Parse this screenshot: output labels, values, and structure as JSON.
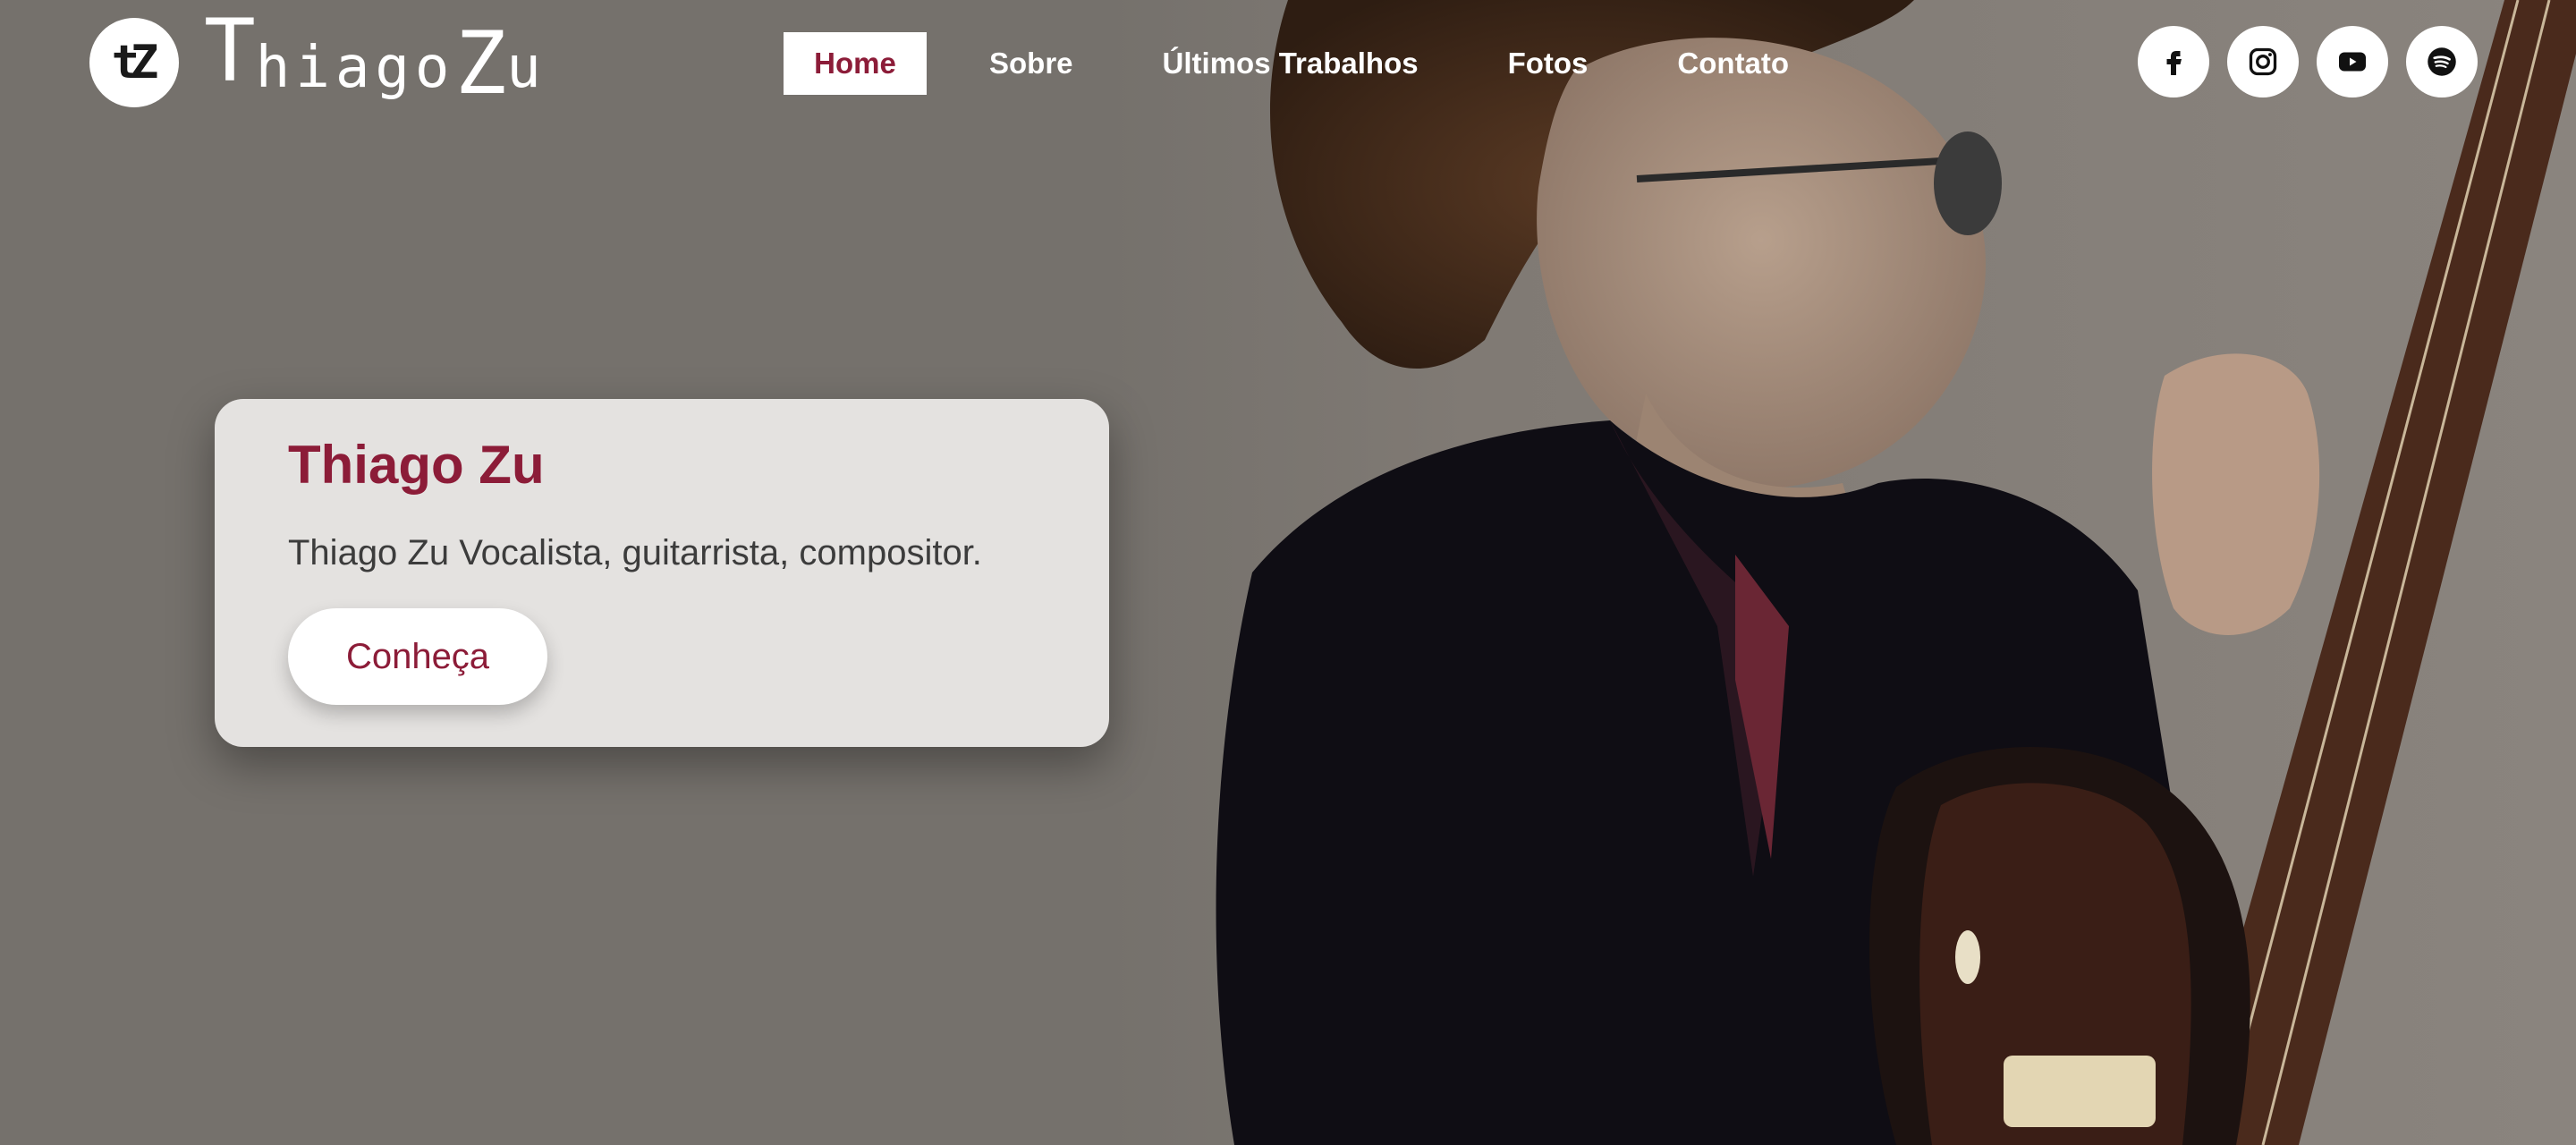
{
  "brand": {
    "logo_mark": "tZ",
    "wordmark_first": "T",
    "wordmark_mid1": "hiago",
    "wordmark_second": "Z",
    "wordmark_mid2": "u"
  },
  "nav": {
    "items": [
      {
        "label": "Home",
        "active": true
      },
      {
        "label": "Sobre"
      },
      {
        "label": "Últimos Trabalhos"
      },
      {
        "label": "Fotos"
      },
      {
        "label": "Contato"
      }
    ]
  },
  "socials": [
    {
      "icon": "facebook-icon"
    },
    {
      "icon": "instagram-icon"
    },
    {
      "icon": "youtube-icon"
    },
    {
      "icon": "spotify-icon"
    }
  ],
  "hero": {
    "title": "Thiago Zu",
    "subtitle": "Thiago Zu Vocalista, guitarrista, compositor.",
    "button_label": "Conheça"
  },
  "colors": {
    "accent": "#8c1c38",
    "background": "#75716c",
    "card": "#e4e2e0"
  }
}
